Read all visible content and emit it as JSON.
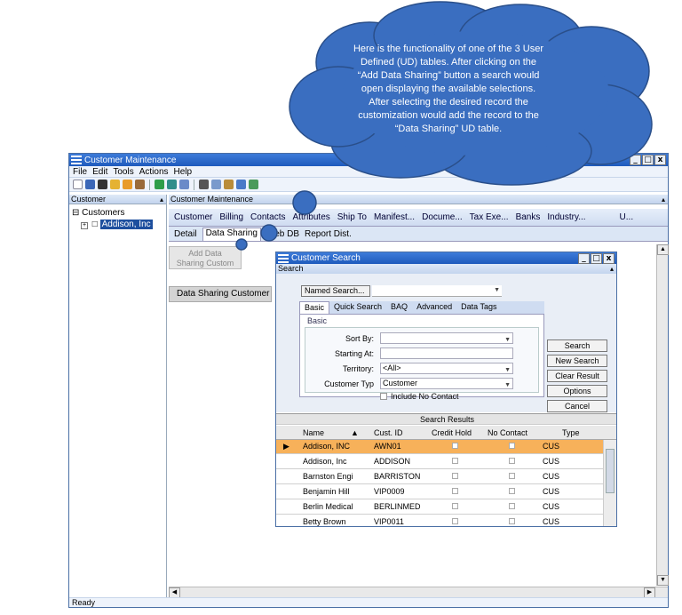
{
  "callout": {
    "line1": "Here is the functionality of one of the 3 User",
    "line2": "Defined (UD) tables.  After clicking on the",
    "line3": "“Add Data Sharing” button a search would",
    "line4": "open displaying the available selections.",
    "line5": "After selecting the desired record the",
    "line6": "customization would add the record to the",
    "line7": "“Data Sharing” UD table."
  },
  "window": {
    "title": "Customer Maintenance",
    "controls": [
      "_",
      "□",
      "x"
    ]
  },
  "menu": [
    "File",
    "Edit",
    "Tools",
    "Actions",
    "Help"
  ],
  "left_panel": {
    "header": "Customer",
    "root": "Customers",
    "child": "Addison, Inc"
  },
  "right_panel": {
    "header": "Customer Maintenance",
    "tabs": [
      "Customer",
      "Billing",
      "Contacts",
      "Attributes",
      "Ship To",
      "Manifest...",
      "Docume...",
      "Tax Exe...",
      "Banks",
      "Industry...",
      "U..."
    ],
    "subtabs": [
      "Detail",
      "Data Sharing",
      "Web DB",
      "Report Dist."
    ],
    "add_button_line1": "Add Data",
    "add_button_line2": "Sharing Custom",
    "column_header": "Data Sharing Customer"
  },
  "status": "Ready",
  "dialog": {
    "title": "Customer Search",
    "subheader": "Search",
    "named_search": "Named Search...",
    "tabs": [
      "Basic",
      "Quick Search",
      "BAQ",
      "Advanced",
      "Data Tags"
    ],
    "frame_title": "Basic",
    "labels": {
      "sort_by": "Sort By:",
      "starting_at": "Starting At:",
      "territory": "Territory:",
      "customer_type": "Customer Typ"
    },
    "values": {
      "sort_by": "",
      "starting_at": "",
      "territory": "<All>",
      "customer_type": "Customer"
    },
    "include_no_contact": "Include No Contact",
    "buttons": [
      "Search",
      "New Search",
      "Clear Result",
      "Options",
      "Cancel"
    ],
    "results_title": "Search Results",
    "columns": [
      "Name",
      "Cust. ID",
      "Credit Hold",
      "No Contact",
      "Type"
    ],
    "rows": [
      {
        "name": "Addison, INC",
        "id": "AWN01",
        "type": "CUS"
      },
      {
        "name": "Addison, Inc",
        "id": "ADDISON",
        "type": "CUS"
      },
      {
        "name": "Barnston Engi",
        "id": "BARRISTON",
        "type": "CUS"
      },
      {
        "name": "Benjamin Hill",
        "id": "VIP0009",
        "type": "CUS"
      },
      {
        "name": "Berlin Medical",
        "id": "BERLINMED",
        "type": "CUS"
      },
      {
        "name": "Betty Brown",
        "id": "VIP0011",
        "type": "CUS"
      }
    ]
  },
  "colors": {
    "title_bar": "#1f5bbd",
    "cloud": "#3a6ec0",
    "highlight_row": "#f7b15a",
    "selection": "#1d4f9e"
  }
}
